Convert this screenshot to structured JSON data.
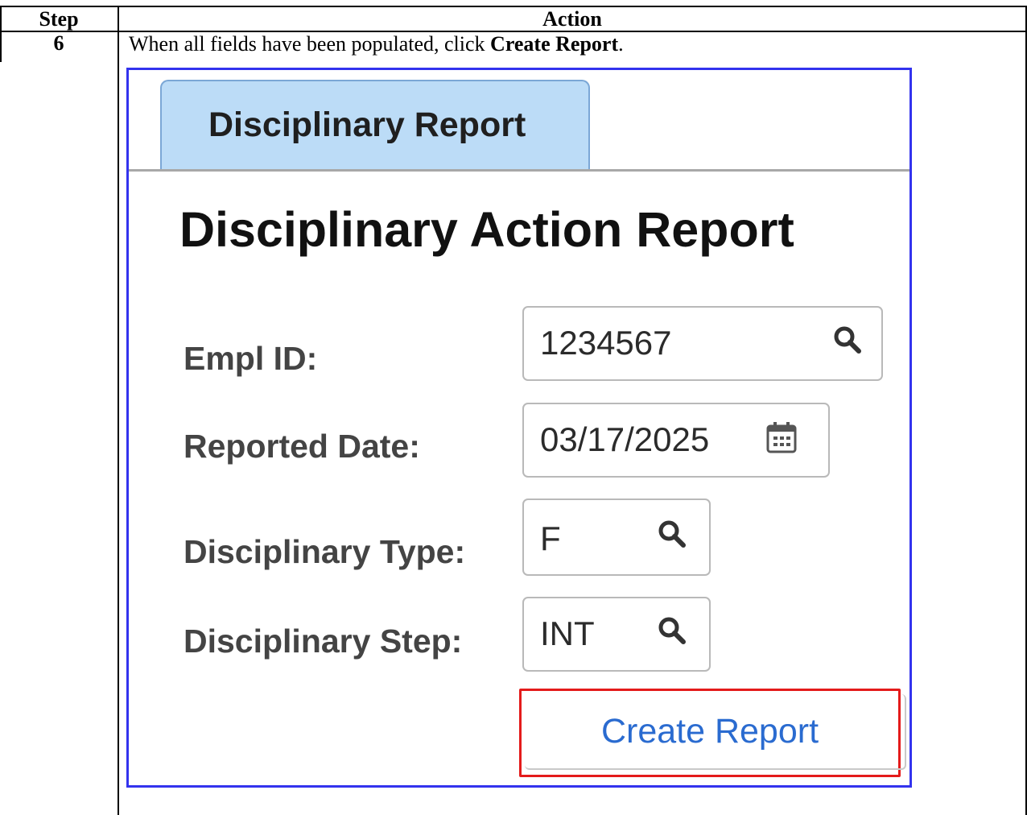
{
  "table": {
    "header_step": "Step",
    "header_action": "Action",
    "step_number": "6",
    "instruction_prefix": "When all fields have been populated, click ",
    "instruction_bold": "Create Report",
    "instruction_suffix": "."
  },
  "screenshot": {
    "tab_label": "Disciplinary Report",
    "title": "Disciplinary Action Report",
    "fields": {
      "empl_id": {
        "label": "Empl ID:",
        "value": "1234567",
        "icon": "search-icon"
      },
      "reported_date": {
        "label": "Reported Date:",
        "value": "03/17/2025",
        "icon": "calendar-icon"
      },
      "disciplinary_type": {
        "label": "Disciplinary Type:",
        "value": "F",
        "icon": "search-icon"
      },
      "disciplinary_step": {
        "label": "Disciplinary Step:",
        "value": "INT",
        "icon": "search-icon"
      }
    },
    "create_button_label": "Create Report",
    "colors": {
      "frame_border": "#3333ee",
      "highlight_border": "#e41b1b",
      "tab_background": "#bcdcf7",
      "button_text": "#2a6bd0"
    }
  }
}
